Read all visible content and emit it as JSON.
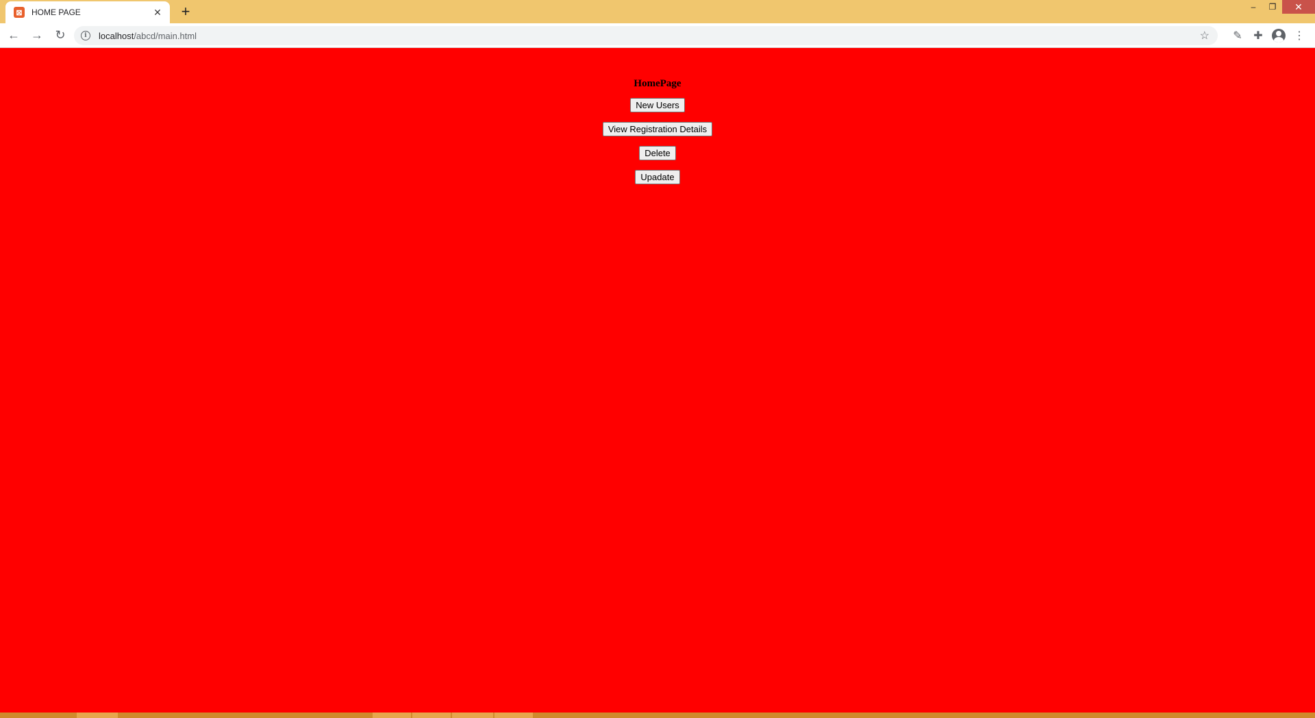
{
  "browser": {
    "tab_title": "HOME PAGE",
    "favicon": "xampp-icon",
    "url_host": "localhost",
    "url_path": "/abcd/main.html",
    "window_controls": [
      "minimize",
      "restore",
      "close"
    ]
  },
  "page": {
    "heading": "HomePage",
    "background_color": "#ff0000",
    "buttons": [
      {
        "label": "New Users"
      },
      {
        "label": "View Registration Details"
      },
      {
        "label": "Delete"
      },
      {
        "label": "Upadate"
      }
    ]
  }
}
